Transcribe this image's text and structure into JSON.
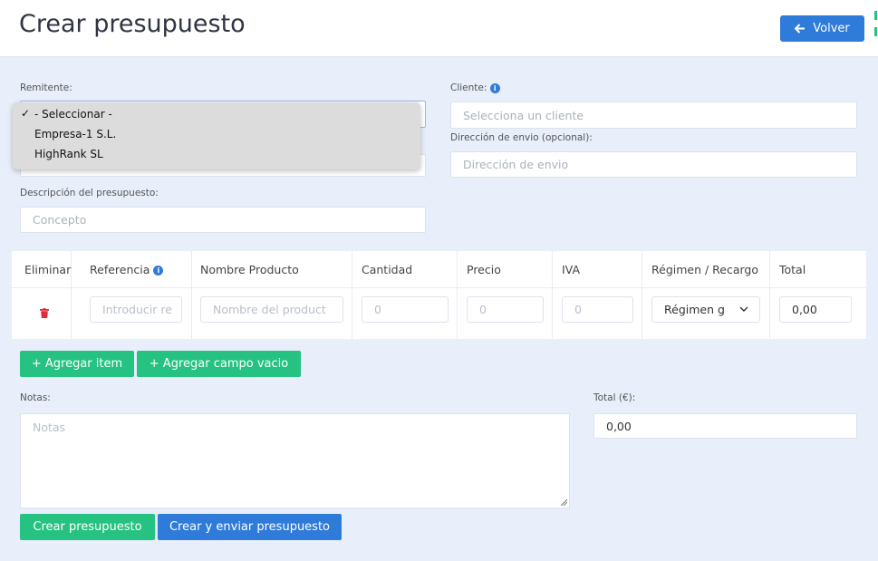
{
  "header": {
    "title": "Crear presupuesto",
    "back_label": "Volver"
  },
  "form": {
    "remitente_label": "Remitente:",
    "remitente_options": [
      "- Seleccionar -",
      "Empresa-1 S.L.",
      "HighRank SL"
    ],
    "cliente_label": "Cliente:",
    "cliente_placeholder": "Selecciona un cliente",
    "direccion_label": "Dirección de envio (opcional):",
    "direccion_placeholder": "Dirección de envio",
    "descripcion_label": "Descripción del presupuesto:",
    "descripcion_placeholder": "Concepto"
  },
  "table": {
    "headers": [
      "Eliminar",
      "Referencia",
      "Nombre Producto",
      "Cantidad",
      "Precio",
      "IVA",
      "Régimen / Recargo",
      "Total"
    ],
    "row": {
      "referencia_placeholder": "Introducir re",
      "nombre_placeholder": "Nombre del product",
      "cantidad": "0",
      "precio": "0",
      "iva": "0",
      "regimen": "Régimen g",
      "total": "0,00"
    }
  },
  "actions": {
    "add_item": "+ Agregar item",
    "add_empty": "+ Agregar campo vacio",
    "create": "Crear presupuesto",
    "create_send": "Crear y enviar presupuesto"
  },
  "notes": {
    "label": "Notas:",
    "placeholder": "Notas"
  },
  "total": {
    "label": "Total (€):",
    "value": "0,00"
  },
  "colors": {
    "primary": "#2f7bd9",
    "success": "#26c281",
    "danger": "#e02b3c",
    "background": "#e8eefa"
  }
}
